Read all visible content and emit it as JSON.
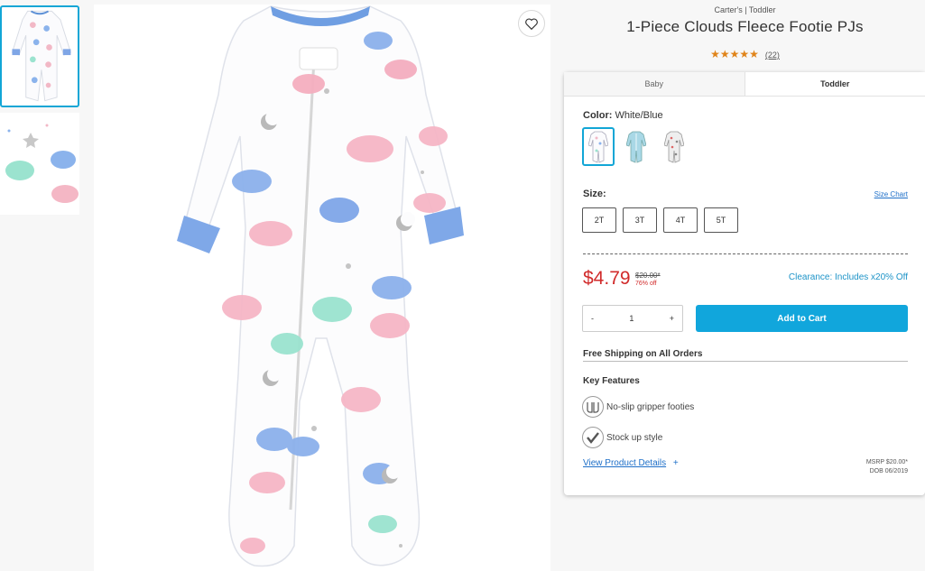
{
  "product": {
    "brand_line": "Carter's | Toddler",
    "title": "1-Piece Clouds Fleece Footie PJs",
    "stars": "★★★★★",
    "review_count": "(22)"
  },
  "tabs": [
    {
      "label": "Baby",
      "active": false
    },
    {
      "label": "Toddler",
      "active": true
    }
  ],
  "color": {
    "label": "Color:",
    "value": "White/Blue",
    "swatches": [
      {
        "name": "white-blue",
        "selected": true
      },
      {
        "name": "light-blue",
        "selected": false
      },
      {
        "name": "pink-print",
        "selected": false
      }
    ]
  },
  "size": {
    "label": "Size:",
    "chart_link": "Size Chart",
    "options": [
      "2T",
      "3T",
      "4T",
      "5T"
    ]
  },
  "pricing": {
    "price": "$4.79",
    "was": "$20.00*",
    "discount": "76% off",
    "clearance": "Clearance: Includes x20% Off"
  },
  "quantity": {
    "minus": "-",
    "value": "1",
    "plus": "+"
  },
  "cart": {
    "button_label": "Add to Cart"
  },
  "shipping": {
    "text": "Free Shipping on All Orders"
  },
  "features": {
    "title": "Key Features",
    "items": [
      {
        "label": "No-slip gripper footies",
        "icon": "footie-icon"
      },
      {
        "label": "Stock up style",
        "icon": "checkmark-icon"
      }
    ]
  },
  "details": {
    "link": "View Product Details",
    "plus": "+",
    "msrp": "MSRP $20.00*",
    "dob": "DOB 06/2019"
  },
  "colors": {
    "accent": "#11a6dc",
    "price_red": "#d12b2b",
    "star_orange": "#e0841a"
  }
}
